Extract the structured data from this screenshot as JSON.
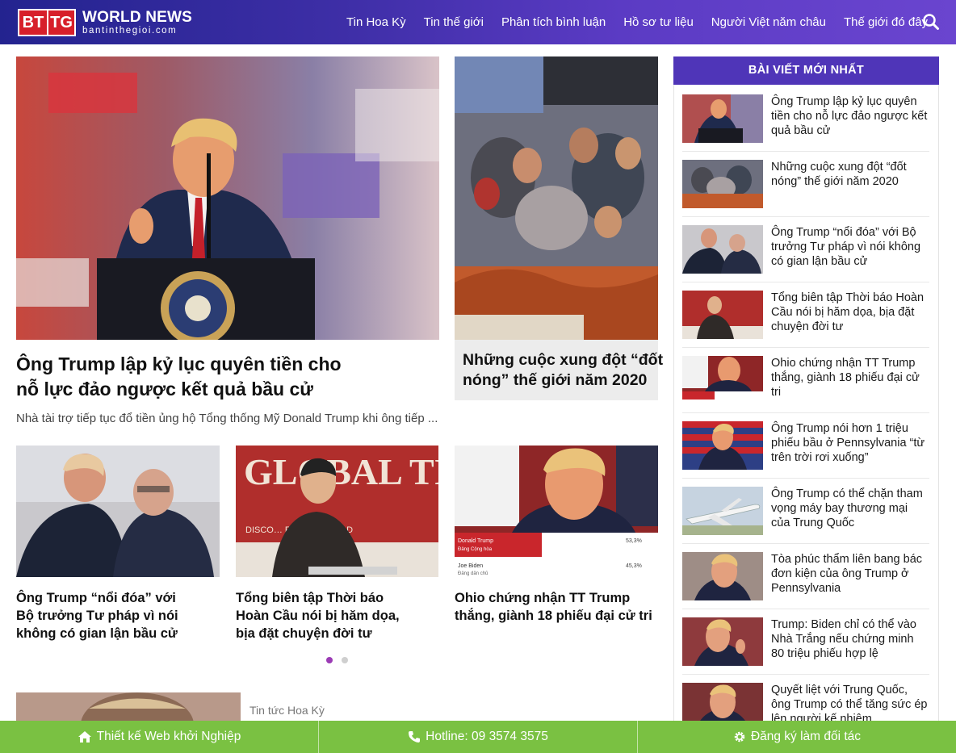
{
  "logo": {
    "mark_left": "BT",
    "mark_right": "TG",
    "title": "WORLD NEWS",
    "subtitle": "bantinthegioi.com"
  },
  "nav": [
    "Tin Hoa Kỳ",
    "Tin thế giới",
    "Phân tích bình luận",
    "Hồ sơ tư liệu",
    "Người Việt năm châu",
    "Thế giới đó đây"
  ],
  "colors": {
    "header_start": "#23238f",
    "header_end": "#6a45cf",
    "sidebar_header": "#4f35b8",
    "footer": "#7ac142",
    "dot_active": "#9b3bb5"
  },
  "featured": {
    "main": {
      "title_line1": "Ông Trump lập kỷ lục quyên tiền cho",
      "title_line2": "nỗ lực đảo ngược kết quả bầu cử",
      "excerpt": "Nhà tài trợ tiếp tục đổ tiền ủng hộ Tổng thống Mỹ Donald Trump khi ông tiếp ..."
    },
    "side": {
      "title_line1": "Những cuộc xung đột “đốt",
      "title_line2": "nóng” thế giới năm 2020"
    }
  },
  "grid": [
    {
      "l1": "Ông Trump “nổi đóa” với",
      "l2": "Bộ trưởng Tư pháp vì nói",
      "l3": "không có gian lận bầu cử"
    },
    {
      "l1": "Tổng biên tập Thời báo",
      "l2": "Hoàn Cầu nói bị hăm dọa,",
      "l3": "bịa đặt chuyện đời tư"
    },
    {
      "l1": "Ohio chứng nhận TT Trump",
      "l2": "thắng, giành 18 phiếu đại cử tri",
      "l3": ""
    }
  ],
  "banner_texts": {
    "global_times": "GLOBAL TIMES",
    "global_times_sub": "DISCO… ER THE WORLD",
    "donald_trump": "Donald Trump",
    "dang_cong_hoa": "Đảng Cộng hòa",
    "trump_pct": "53,3%",
    "joe_biden": "Joe Biden",
    "dang_dan_chu": "Đảng dân chủ",
    "biden_pct": "45,3%"
  },
  "below_category": "Tin tức Hoa Kỳ",
  "sidebar": {
    "title": "BÀI VIẾT MỚI NHẤT",
    "items": [
      {
        "text": "Ông Trump lập kỷ lục quyên tiền cho nỗ lực đảo ngược kết quả bầu cử"
      },
      {
        "text": "Những cuộc xung đột “đốt nóng” thế giới năm 2020"
      },
      {
        "text": "Ông Trump “nổi đóa” với Bộ trưởng Tư pháp vì nói không có gian lận bầu cử"
      },
      {
        "text": "Tổng biên tập Thời báo Hoàn Cầu nói bị hăm dọa, bịa đặt chuyện đời tư"
      },
      {
        "text": "Ohio chứng nhận TT Trump thắng, giành 18 phiếu đại cử tri"
      },
      {
        "text": "Ông Trump nói hơn 1 triệu phiếu bầu ở Pennsylvania “từ trên trời rơi xuống”"
      },
      {
        "text": "Ông Trump có thể chặn tham vọng máy bay thương mại của Trung Quốc"
      },
      {
        "text": "Tòa phúc thẩm liên bang bác đơn kiện của ông Trump ở Pennsylvania"
      },
      {
        "text": "Trump: Biden chỉ có thể vào Nhà Trắng nếu chứng minh 80 triệu phiếu hợp lệ"
      },
      {
        "text": "Quyết liệt với Trung Quốc, ông Trump có thể tăng sức ép lên người kế nhiệm"
      }
    ]
  },
  "footer": {
    "startup": "Thiết kế Web khởi Nghiệp",
    "hotline": "Hotline: 09 3574 3575",
    "partner": "Đăng ký làm đối tác"
  }
}
